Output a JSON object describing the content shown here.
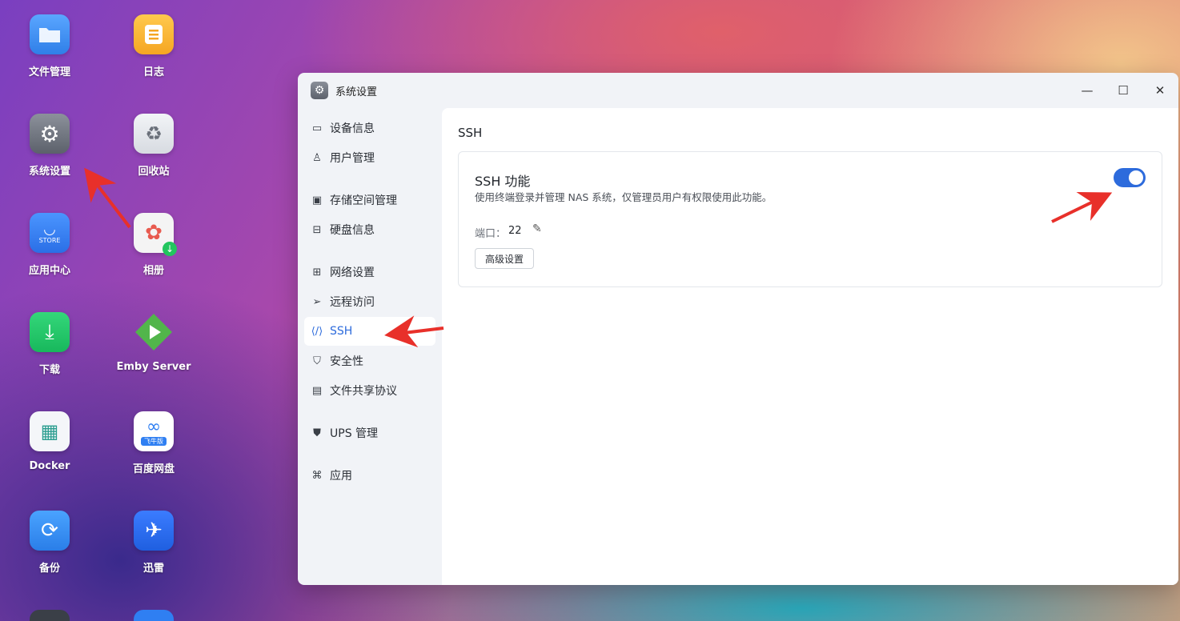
{
  "desktop": {
    "icons": [
      {
        "label": "文件管理",
        "icon": "folder-icon",
        "color": "#3b8df0"
      },
      {
        "label": "日志",
        "icon": "log-icon",
        "color": "#f5a623"
      },
      {
        "label": "系统设置",
        "icon": "gear-icon",
        "color": "#6b707a"
      },
      {
        "label": "回收站",
        "icon": "recycle-icon",
        "color": "#e8eaee"
      },
      {
        "label": "应用中心",
        "icon": "store-icon",
        "color": "#2f7ff2"
      },
      {
        "label": "相册",
        "icon": "photos-icon",
        "color": "#f2f2f2"
      },
      {
        "label": "下载",
        "icon": "download-icon",
        "color": "#22c55e"
      },
      {
        "label": "Emby Server",
        "icon": "emby-icon",
        "color": "#52b54b"
      },
      {
        "label": "Docker",
        "icon": "docker-icon",
        "color": "#f5f7fa"
      },
      {
        "label": "百度网盘",
        "icon": "baidu-netdisk-icon",
        "color": "#ffffff"
      },
      {
        "label": "备份",
        "icon": "backup-icon",
        "color": "#2f8ff2"
      },
      {
        "label": "迅雷",
        "icon": "xunlei-icon",
        "color": "#2d6bf0"
      }
    ],
    "store_badge": "STORE",
    "baidu_badge": "飞牛版"
  },
  "window": {
    "title": "系统设置",
    "controls": {
      "minimize": "—",
      "maximize": "☐",
      "close": "✕"
    }
  },
  "sidebar": {
    "items": [
      {
        "label": "设备信息",
        "icon": "device-icon"
      },
      {
        "label": "用户管理",
        "icon": "user-icon"
      },
      {
        "label": "存储空间管理",
        "icon": "storage-icon"
      },
      {
        "label": "硬盘信息",
        "icon": "disk-icon"
      },
      {
        "label": "网络设置",
        "icon": "network-icon"
      },
      {
        "label": "远程访问",
        "icon": "remote-icon"
      },
      {
        "label": "SSH",
        "icon": "code-icon",
        "active": true
      },
      {
        "label": "安全性",
        "icon": "shield-check-icon"
      },
      {
        "label": "文件共享协议",
        "icon": "file-icon"
      },
      {
        "label": "UPS 管理",
        "icon": "shield-icon"
      },
      {
        "label": "应用",
        "icon": "apps-icon"
      }
    ]
  },
  "ssh": {
    "section_title": "SSH",
    "card_title": "SSH 功能",
    "description": "使用终端登录并管理 NAS 系统，仅管理员用户有权限使用此功能。",
    "port_label": "端口：",
    "port_value": "22",
    "advanced_button": "高级设置",
    "enabled": true
  },
  "colors": {
    "accent": "#2d6bdc",
    "annotation_arrow": "#e8302a"
  }
}
